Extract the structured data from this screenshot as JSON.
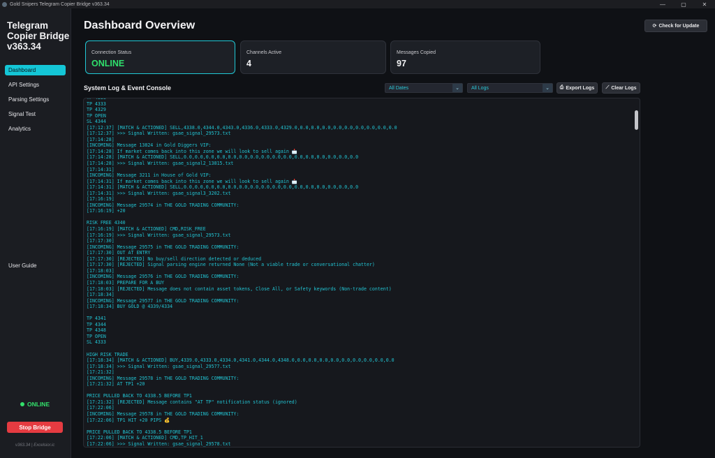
{
  "window": {
    "title": "Gold Snipers Telegram Copier Bridge v363.34",
    "controls": [
      "—",
      "▢",
      "✕"
    ]
  },
  "sidebar": {
    "brand": "Telegram Copier Bridge v363.34",
    "items": [
      {
        "label": "Dashboard",
        "active": true
      },
      {
        "label": "API Settings",
        "active": false
      },
      {
        "label": "Parsing Settings",
        "active": false
      },
      {
        "label": "Signal Test",
        "active": false
      },
      {
        "label": "Analytics",
        "active": false
      }
    ],
    "user_guide": "User Guide",
    "status": "ONLINE",
    "stop_button": "Stop Bridge",
    "version_footer": "v363.34 | Excelsior.ic"
  },
  "header": {
    "title": "Dashboard Overview",
    "update_button": "Check for Update"
  },
  "cards": [
    {
      "label": "Connection Status",
      "value": "ONLINE"
    },
    {
      "label": "Channels Active",
      "value": "4"
    },
    {
      "label": "Messages Copied",
      "value": "97"
    }
  ],
  "console": {
    "title": "System Log & Event Console",
    "date_filter": "All Dates",
    "log_filter": "All Logs",
    "export_button": "Export Logs",
    "clear_button": "Clear Logs",
    "lines": [
      "TP 4338",
      "TP 4333",
      "TP 4329",
      "TP OPEN",
      "SL 4344",
      "[17:12:37] [MATCH & ACTIONED] SELL,4338.0,4344.0,4343.0,4336.0,4333.0,4329.0,0.0,0.0,0.0,0.0,0.0,0.0,0.0,0.0,0.0",
      "[17:12:37] >>> Signal Written: gsae_signal_29573.txt",
      "[17:14:28]",
      "[INCOMING] Message 13824 in Gold Diggers VIP:",
      "[17:14:28] If market comes back into this zone we will look to sell again 📩",
      "[17:14:28] [MATCH & ACTIONED] SELL,0.0,0.0,0.0,0.0,0.0,0.0,0.0,0.0,0.0,0.0,0.0,0.0,0.0,0.0,0.0,0.0",
      "[17:14:28] >>> Signal Written: gsae_signal2_13815.txt",
      "[17:14:31]",
      "[INCOMING] Message 3211 in House of Gold VIP:",
      "[17:14:31] If market comes back into this zone we will look to sell again 📩",
      "[17:14:31] [MATCH & ACTIONED] SELL,0.0,0.0,0.0,0.0,0.0,0.0,0.0,0.0,0.0,0.0,0.0,0.0,0.0,0.0,0.0,0.0",
      "[17:14:31] >>> Signal Written: gsae_signal3_3202.txt",
      "[17:16:19]",
      "[INCOMING] Message 29574 in THE GOLD TRADING COMMUNITY:",
      "[17:16:19] +20",
      "",
      "RISK FREE 4340",
      "[17:16:19] [MATCH & ACTIONED] CMD,RISK_FREE",
      "[17:16:19] >>> Signal Written: gsae_signal_29573.txt",
      "[17:17:30]",
      "[INCOMING] Message 29575 in THE GOLD TRADING COMMUNITY:",
      "[17:17:30] OUT AT ENTRY",
      "[17:17:30] [REJECTED] No buy/sell direction detected or deduced",
      "[17:17:30] [REJECTED] Signal parsing engine returned None (Not a viable trade or conversational chatter)",
      "[17:18:03]",
      "[INCOMING] Message 29576 in THE GOLD TRADING COMMUNITY:",
      "[17:18:03] PREPARE FOR A BUY",
      "[17:18:03] [REJECTED] Message does not contain asset tokens, Close All, or Safety keywords (Non-trade content)",
      "[17:18:34]",
      "[INCOMING] Message 29577 in THE GOLD TRADING COMMUNITY:",
      "[17:18:34] BUY GOLD @ 4339/4334",
      "",
      "TP 4341",
      "TP 4344",
      "TP 4348",
      "TP OPEN",
      "SL 4333",
      "",
      "HIGH RISK TRADE",
      "[17:18:34] [MATCH & ACTIONED] BUY,4339.0,4333.0,4334.0,4341.0,4344.0,4348.0,0.0,0.0,0.0,0.0,0.0,0.0,0.0,0.0,0.0",
      "[17:18:34] >>> Signal Written: gsae_signal_29577.txt",
      "[17:21:32]",
      "[INCOMING] Message 29578 in THE GOLD TRADING COMMUNITY:",
      "[17:21:32] AT TP1 +20",
      "",
      "PRICE PULLED BACK TO 4338.5 BEFORE TP1",
      "[17:21:32] [REJECTED] Message contains \"AT TP\" notification status (ignored)",
      "[17:22:06]",
      "[INCOMING] Message 29578 in THE GOLD TRADING COMMUNITY:",
      "[17:22:06] TP1 HIT +20 PIPS 💰",
      "",
      "PRICE PULLED BACK TO 4338.5 BEFORE TP1",
      "[17:22:06] [MATCH & ACTIONED] CMD,TP_HIT_1",
      "[17:22:06] >>> Signal Written: gsae_signal_29578.txt"
    ]
  },
  "colors": {
    "accent": "#14c6d6",
    "online": "#2fe06c",
    "stop": "#e53b41",
    "log_text": "#22c4d3"
  }
}
